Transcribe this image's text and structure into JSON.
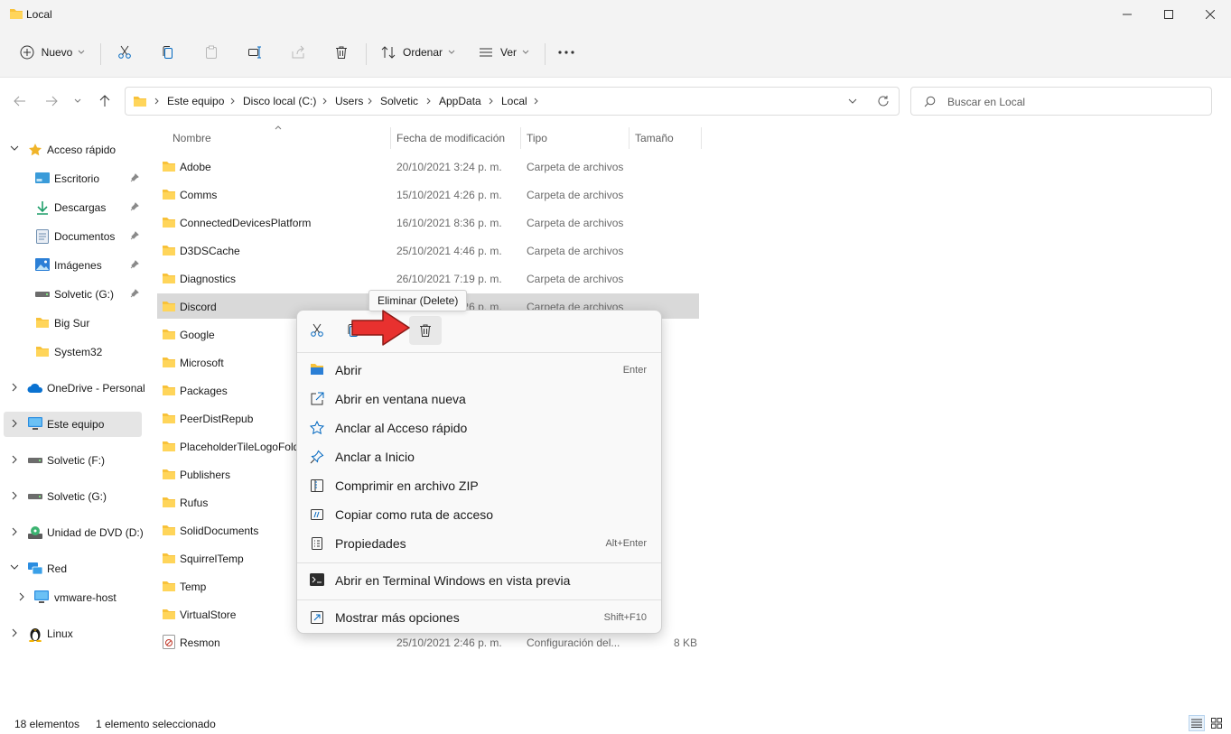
{
  "window": {
    "title": "Local"
  },
  "toolbar": {
    "new_label": "Nuevo",
    "sort_label": "Ordenar",
    "view_label": "Ver",
    "more_label": "···"
  },
  "address": {
    "crumbs": [
      "Este equipo",
      "Disco local (C:)",
      "Users",
      "Solvetic",
      "AppData",
      "Local"
    ]
  },
  "search": {
    "placeholder": "Buscar en Local"
  },
  "sidebar": {
    "items": [
      {
        "label": "Acceso rápido"
      },
      {
        "label": "Escritorio"
      },
      {
        "label": "Descargas"
      },
      {
        "label": "Documentos"
      },
      {
        "label": "Imágenes"
      },
      {
        "label": "Solvetic (G:)"
      },
      {
        "label": "Big Sur"
      },
      {
        "label": "System32"
      },
      {
        "label": "OneDrive - Personal"
      },
      {
        "label": "Este equipo"
      },
      {
        "label": "Solvetic (F:)"
      },
      {
        "label": "Solvetic (G:)"
      },
      {
        "label": "Unidad de DVD (D:)"
      },
      {
        "label": "Red"
      },
      {
        "label": "vmware-host"
      },
      {
        "label": "Linux"
      }
    ]
  },
  "columns": {
    "name": "Nombre",
    "date": "Fecha de modificación",
    "type": "Tipo",
    "size": "Tamaño"
  },
  "files": [
    {
      "name": "Adobe",
      "date": "20/10/2021 3:24 p. m.",
      "type": "Carpeta de archivos",
      "size": ""
    },
    {
      "name": "Comms",
      "date": "15/10/2021 4:26 p. m.",
      "type": "Carpeta de archivos",
      "size": ""
    },
    {
      "name": "ConnectedDevicesPlatform",
      "date": "16/10/2021 8:36 p. m.",
      "type": "Carpeta de archivos",
      "size": ""
    },
    {
      "name": "D3DSCache",
      "date": "25/10/2021 4:46 p. m.",
      "type": "Carpeta de archivos",
      "size": ""
    },
    {
      "name": "Diagnostics",
      "date": "26/10/2021 7:19 p. m.",
      "type": "Carpeta de archivos",
      "size": ""
    },
    {
      "name": "Discord",
      "date": "26/10/2021 7:26 p. m.",
      "type": "Carpeta de archivos",
      "size": ""
    },
    {
      "name": "Google",
      "date": "",
      "type": "",
      "size": ""
    },
    {
      "name": "Microsoft",
      "date": "",
      "type": "",
      "size": ""
    },
    {
      "name": "Packages",
      "date": "",
      "type": "",
      "size": ""
    },
    {
      "name": "PeerDistRepub",
      "date": "",
      "type": "",
      "size": ""
    },
    {
      "name": "PlaceholderTileLogoFolder",
      "date": "",
      "type": "",
      "size": ""
    },
    {
      "name": "Publishers",
      "date": "",
      "type": "",
      "size": ""
    },
    {
      "name": "Rufus",
      "date": "",
      "type": "",
      "size": ""
    },
    {
      "name": "SolidDocuments",
      "date": "",
      "type": "",
      "size": ""
    },
    {
      "name": "SquirrelTemp",
      "date": "",
      "type": "",
      "size": ""
    },
    {
      "name": "Temp",
      "date": "",
      "type": "",
      "size": ""
    },
    {
      "name": "VirtualStore",
      "date": "",
      "type": "",
      "size": ""
    },
    {
      "name": "Resmon",
      "date": "25/10/2021 2:46 p. m.",
      "type": "Configuración del...",
      "size": "8 KB"
    }
  ],
  "context_menu": {
    "tooltip": "Eliminar (Delete)",
    "items": [
      {
        "label": "Abrir",
        "shortcut": "Enter"
      },
      {
        "label": "Abrir en ventana nueva",
        "shortcut": ""
      },
      {
        "label": "Anclar al Acceso rápido",
        "shortcut": ""
      },
      {
        "label": "Anclar a Inicio",
        "shortcut": ""
      },
      {
        "label": "Comprimir en archivo ZIP",
        "shortcut": ""
      },
      {
        "label": "Copiar como ruta de acceso",
        "shortcut": ""
      },
      {
        "label": "Propiedades",
        "shortcut": "Alt+Enter"
      },
      {
        "label": "Abrir en Terminal Windows en vista previa",
        "shortcut": ""
      },
      {
        "label": "Mostrar más opciones",
        "shortcut": "Shift+F10"
      }
    ]
  },
  "status": {
    "count": "18 elementos",
    "selection": "1 elemento seleccionado"
  },
  "colors": {
    "folder": "#f8c23a",
    "accent": "#0067c0",
    "arrow": "#e8312f",
    "selection": "#d9d9d9"
  }
}
